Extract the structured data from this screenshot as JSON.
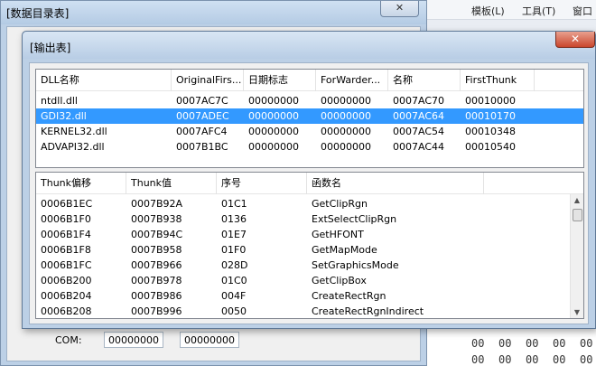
{
  "background_app": {
    "menu": [
      {
        "label": "模板(L)"
      },
      {
        "label": "工具(T)"
      },
      {
        "label": "窗口"
      }
    ],
    "hex_values": [
      "00",
      "00",
      "00",
      "00",
      "00",
      "00",
      "00",
      "00",
      "00",
      "00"
    ]
  },
  "back_window": {
    "title": "[数据目录表]",
    "close_glyph": "✕",
    "com_label": "COM:",
    "com_values": [
      "00000000",
      "00000000"
    ]
  },
  "output_window": {
    "title": "[输出表]",
    "close_glyph": "✕",
    "dll_table": {
      "columns": [
        "DLL名称",
        "OriginalFirs...",
        "日期标志",
        "ForWarder...",
        "名称",
        "FirstThunk"
      ],
      "rows": [
        [
          "ntdll.dll",
          "0007AC7C",
          "00000000",
          "00000000",
          "0007AC70",
          "00010000"
        ],
        [
          "GDI32.dll",
          "0007ADEC",
          "00000000",
          "00000000",
          "0007AC64",
          "00010170"
        ],
        [
          "KERNEL32.dll",
          "0007AFC4",
          "00000000",
          "00000000",
          "0007AC54",
          "00010348"
        ],
        [
          "ADVAPI32.dll",
          "0007B1BC",
          "00000000",
          "00000000",
          "0007AC44",
          "00010540"
        ]
      ],
      "selected_row": 1
    },
    "thunk_table": {
      "columns": [
        "Thunk偏移",
        "Thunk值",
        "序号",
        "函数名"
      ],
      "rows": [
        [
          "0006B1EC",
          "0007B92A",
          "01C1",
          "GetClipRgn"
        ],
        [
          "0006B1F0",
          "0007B938",
          "0136",
          "ExtSelectClipRgn"
        ],
        [
          "0006B1F4",
          "0007B94C",
          "01E7",
          "GetHFONT"
        ],
        [
          "0006B1F8",
          "0007B958",
          "01F0",
          "GetMapMode"
        ],
        [
          "0006B1FC",
          "0007B966",
          "028D",
          "SetGraphicsMode"
        ],
        [
          "0006B200",
          "0007B978",
          "01C0",
          "GetClipBox"
        ],
        [
          "0006B204",
          "0007B986",
          "004F",
          "CreateRectRgn"
        ],
        [
          "0006B208",
          "0007B996",
          "0050",
          "CreateRectRgnIndirect"
        ]
      ]
    }
  }
}
